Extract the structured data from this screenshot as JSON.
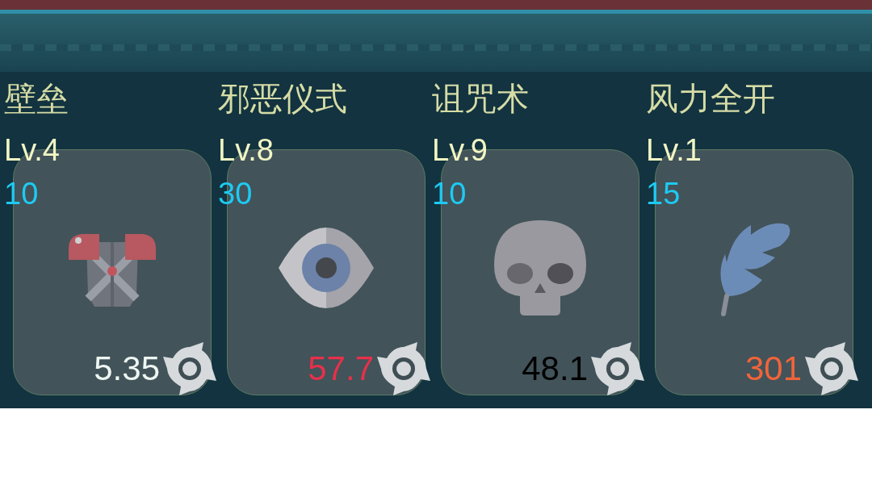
{
  "skills": [
    {
      "name": "壁垒",
      "level": "Lv.4",
      "cost": "10",
      "value": "5.35",
      "color": "#eef6f2",
      "kind": "armor"
    },
    {
      "name": "邪恶仪式",
      "level": "Lv.8",
      "cost": "30",
      "value": "57.7",
      "color": "#e8304a",
      "kind": "eye"
    },
    {
      "name": "诅咒术",
      "level": "Lv.9",
      "cost": "10",
      "value": "48.1",
      "color": "#000000",
      "kind": "skull"
    },
    {
      "name": "风力全开",
      "level": "Lv.1",
      "cost": "15",
      "value": "301",
      "color": "#f0643a",
      "kind": "feather"
    }
  ]
}
